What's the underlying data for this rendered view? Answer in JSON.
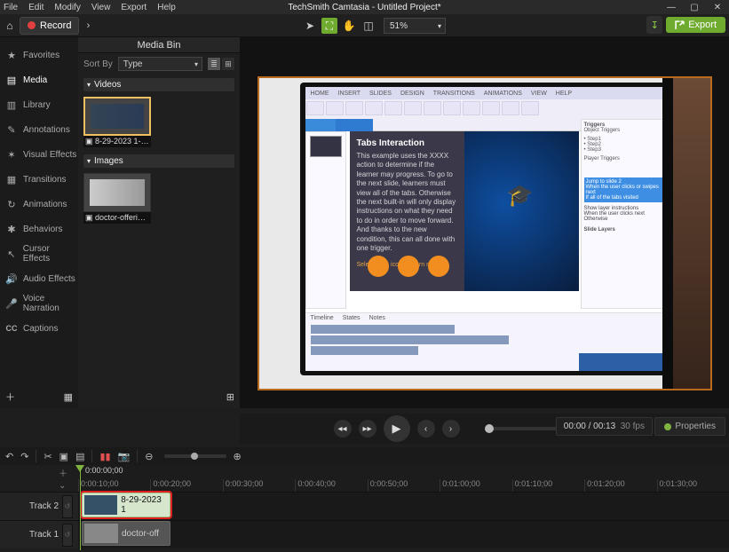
{
  "menu": {
    "file": "File",
    "edit": "Edit",
    "modify": "Modify",
    "view": "View",
    "export": "Export",
    "help": "Help"
  },
  "title": "TechSmith Camtasia - Untitled Project*",
  "record": {
    "label": "Record"
  },
  "canvas": {
    "zoom": "51%",
    "export": "Export"
  },
  "sidebar": {
    "items": [
      {
        "label": "Favorites"
      },
      {
        "label": "Media"
      },
      {
        "label": "Library"
      },
      {
        "label": "Annotations"
      },
      {
        "label": "Visual Effects"
      },
      {
        "label": "Transitions"
      },
      {
        "label": "Animations"
      },
      {
        "label": "Behaviors"
      },
      {
        "label": "Cursor Effects"
      },
      {
        "label": "Audio Effects"
      },
      {
        "label": "Voice Narration"
      },
      {
        "label": "Captions"
      }
    ]
  },
  "bin": {
    "title": "Media Bin",
    "sort_label": "Sort By",
    "sort_value": "Type",
    "groups": {
      "videos": "Videos",
      "images": "Images"
    },
    "video_item": "8-29-2023 1-00-2...",
    "image_item": "doctor-offering-me..."
  },
  "slide": {
    "title": "Tabs Interaction",
    "body": "This example uses the XXXX action to determine if the learner may progress. To go to the next slide, learners must view all of the tabs. Otherwise the next built-in will only display instructions on what they need to do in order to move forward. And thanks to the new condition, this can all done with one trigger.",
    "sub": "Select each icon to learn more.",
    "tab_names": [
      "HOME",
      "INSERT",
      "SLIDES",
      "DESIGN",
      "TRANSITIONS",
      "ANIMATIONS",
      "VIEW",
      "HELP"
    ],
    "panel_title": "Triggers",
    "object_triggers": "Object Triggers",
    "player_triggers": "Player Triggers",
    "slide_layers": "Slide Layers",
    "timeline_tabs": [
      "Timeline",
      "States",
      "Notes"
    ]
  },
  "player": {
    "time": "00:00 / 00:13",
    "fps": "30 fps",
    "properties": "Properties"
  },
  "timeline": {
    "playhead_time": "0:00:00;00",
    "marks": [
      "0:00:10;00",
      "0:00:20;00",
      "0:00:30;00",
      "0:00:40;00",
      "0:00:50;00",
      "0:01:00;00",
      "0:01:10;00",
      "0:01:20;00",
      "0:01:30;00"
    ],
    "track2": "Track 2",
    "track1": "Track 1",
    "clip_a": "8-29-2023 1",
    "clip_b": "doctor-off"
  }
}
